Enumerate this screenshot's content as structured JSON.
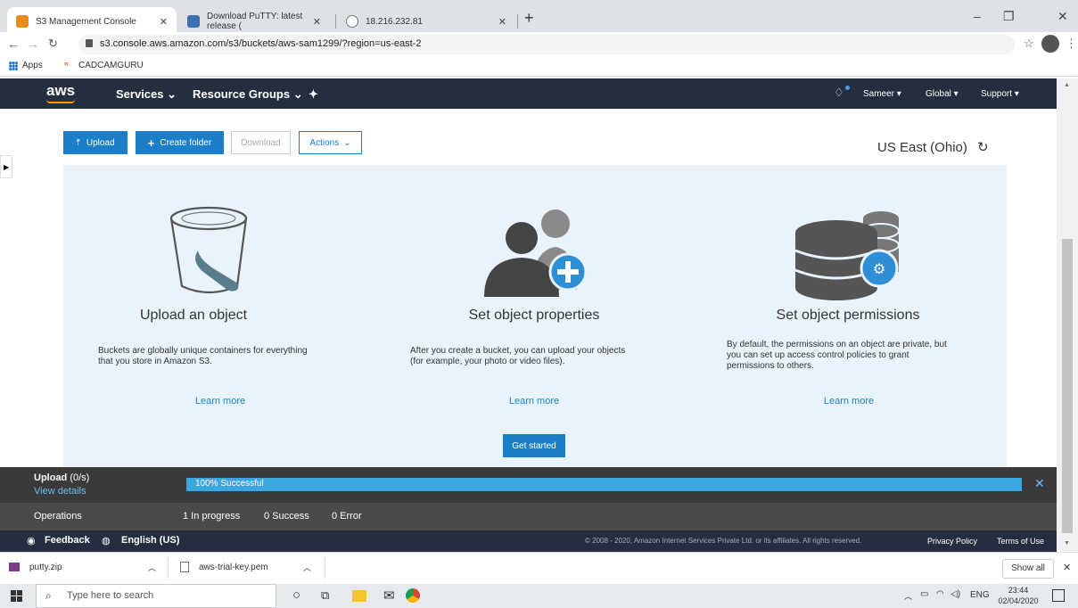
{
  "browser": {
    "tabs": [
      {
        "title": "S3 Management Console",
        "icon": "aws-favicon",
        "color": "#e88a1a"
      },
      {
        "title": "Download PuTTY: latest release (",
        "icon": "putty-favicon",
        "color": "#3c6fb4"
      },
      {
        "title": "18.216.232.81",
        "icon": "globe-icon",
        "color": "#777777"
      }
    ],
    "new_tab": "+",
    "window_controls": {
      "minimize": "–",
      "maximize": "❐",
      "close": "✕"
    },
    "url": "s3.console.aws.amazon.com/s3/buckets/aws-sam1299/?region=us-east-2",
    "bookmarks": [
      {
        "label": "Apps"
      },
      {
        "label": "CADCAMGURU"
      }
    ]
  },
  "aws_nav": {
    "logo": "aws",
    "services": "Services",
    "resource_groups": "Resource Groups",
    "user": "Sameer",
    "region_menu": "Global",
    "support": "Support"
  },
  "toolbar": {
    "upload": "Upload",
    "create_folder": "Create folder",
    "download": "Download",
    "actions": "Actions",
    "region": "US East (Ohio)"
  },
  "cards": [
    {
      "title": "Upload an object",
      "desc_line1": "Buckets are globally unique containers for everything",
      "desc_line2": "that you store in Amazon S3.",
      "learn_more": "Learn more"
    },
    {
      "title": "Set object properties",
      "desc_line1": "After you create a bucket, you can upload your objects",
      "desc_line2": "(for example, your photo or video files).",
      "learn_more": "Learn more"
    },
    {
      "title": "Set object permissions",
      "desc_line1": "By default, the permissions on an object are private, but",
      "desc_line2": "you can set up access control policies to grant",
      "desc_line3": "permissions to others.",
      "learn_more": "Learn more"
    }
  ],
  "get_started": "Get started",
  "upload_panel": {
    "title": "Upload",
    "count": "(0/s)",
    "view_details": "View details",
    "progress_text": "100% Successful",
    "progress": 1.0,
    "operations": "Operations",
    "in_progress": "1 In progress",
    "success": "0 Success",
    "error": "0 Error"
  },
  "footer": {
    "feedback": "Feedback",
    "language": "English (US)",
    "copyright": "© 2008 - 2020, Amazon Internet Services Private Ltd. or its affiliates. All rights reserved.",
    "privacy": "Privacy Policy",
    "terms": "Terms of Use"
  },
  "downloads": {
    "items": [
      {
        "name": "putty.zip"
      },
      {
        "name": "aws-trial-key.pem"
      }
    ],
    "show_all": "Show all"
  },
  "taskbar": {
    "search_placeholder": "Type here to search",
    "lang": "ENG",
    "time": "23:44",
    "date": "02/04/2020"
  },
  "colors": {
    "aws_dark": "#232f3e",
    "primary_blue": "#1a7fc8",
    "hero_bg": "#e8f3fb",
    "progress_blue": "#3ba7e0"
  }
}
